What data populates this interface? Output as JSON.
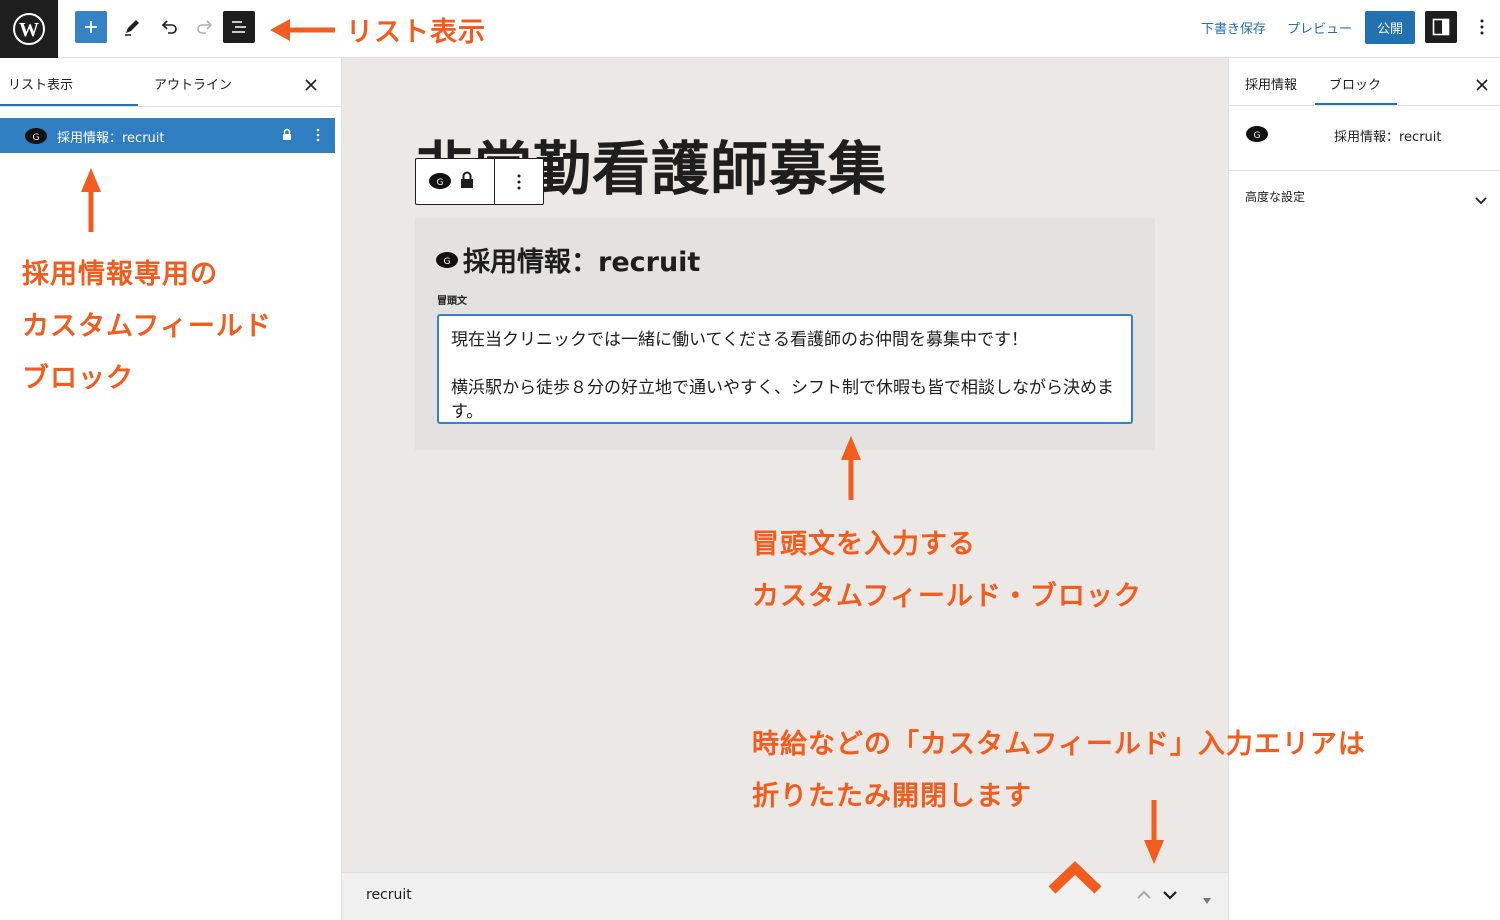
{
  "topbar": {
    "save_draft": "下書き保存",
    "preview": "プレビュー",
    "publish": "公開"
  },
  "left_panel": {
    "tab_list": "リスト表示",
    "tab_outline": "アウトライン",
    "item_label": "採用情報：recruit"
  },
  "canvas": {
    "post_title": "非常勤看護師募集",
    "block_title": "採用情報：recruit",
    "field_label": "冒頭文",
    "field_value": "現在当クリニックでは一緒に働いてくださる看護師のお仲間を募集中です！\n\n横浜駅から徒歩８分の好立地で通いやすく、シフト制で休暇も皆で相談しながら決めます。"
  },
  "bottom_bar": {
    "label": "recruit"
  },
  "right_panel": {
    "tab_post": "採用情報",
    "tab_block": "ブロック",
    "block_name": "採用情報：recruit",
    "advanced": "高度な設定"
  },
  "annotations": {
    "list_view": "リスト表示",
    "left_line1": "採用情報専用の",
    "left_line2": "カスタムフィールド",
    "left_line3": "ブロック",
    "center_line1": "冒頭文を入力する",
    "center_line2": "カスタムフィールド・ブロック",
    "bottom_line1": "時給などの「カスタムフィールド」入力エリアは",
    "bottom_line2": "折りたたみ開閉します"
  },
  "colors": {
    "accent": "#2271b1",
    "annotation": "#f25c1f",
    "canvas_bg": "#ebe8e5"
  }
}
